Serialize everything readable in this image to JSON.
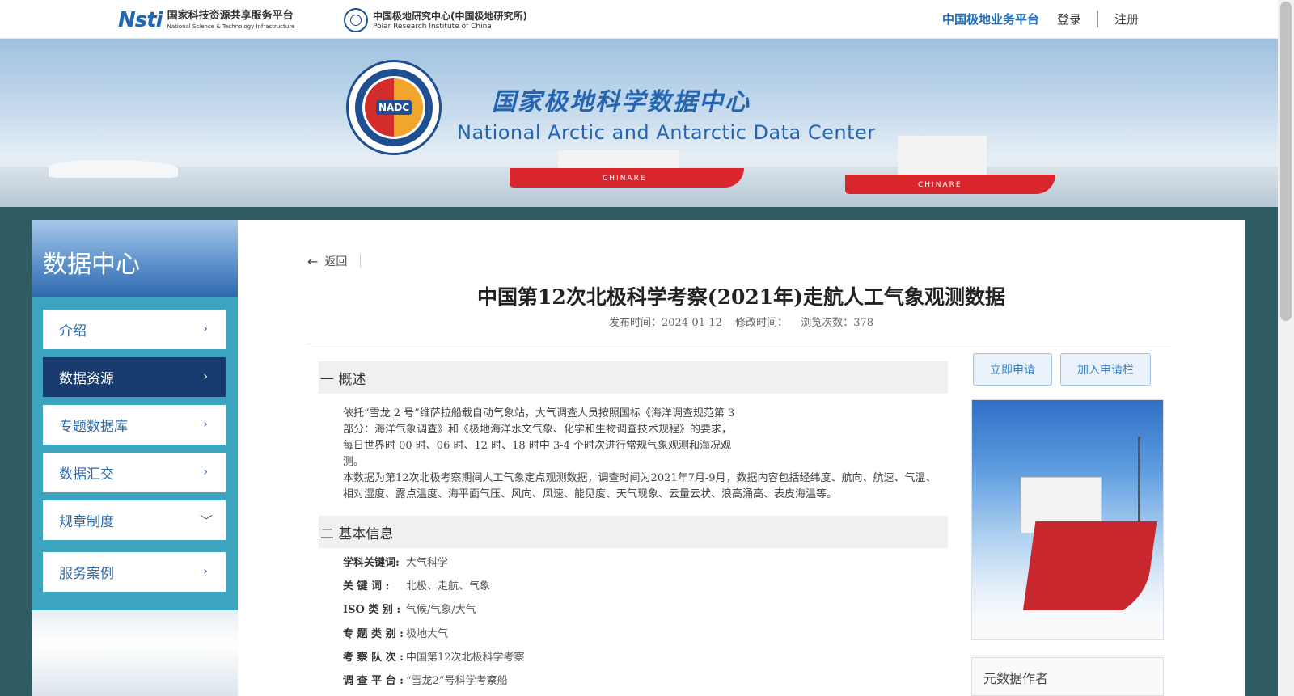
{
  "topbar": {
    "nsti_mark": "Nsti",
    "nsti_cn": "国家科技资源共享服务平台",
    "nsti_en": "National Science & Technology Infrastructure",
    "pric_cn": "中国极地研究中心(中国极地研究所)",
    "pric_en": "Polar Research Institute of China",
    "platform": "中国极地业务平台",
    "login": "登录",
    "register": "注册"
  },
  "banner": {
    "seal_text": "NADC",
    "title_cn": "国家极地科学数据中心",
    "title_en": "National Arctic and Antarctic Data Center",
    "ship_label": "CHINARE"
  },
  "sidebar": {
    "title": "数据中心",
    "items": [
      {
        "label": "介绍",
        "icon": "chevron-right-icon",
        "glyph": "›"
      },
      {
        "label": "数据资源",
        "icon": "chevron-right-icon",
        "glyph": "›",
        "active": true
      },
      {
        "label": "专题数据库",
        "icon": "chevron-right-icon",
        "glyph": "›"
      },
      {
        "label": "数据汇交",
        "icon": "chevron-right-icon",
        "glyph": "›"
      },
      {
        "label": "规章制度",
        "icon": "chevron-down-icon",
        "glyph": "﹀"
      },
      {
        "label": "服务案例",
        "icon": "chevron-right-icon",
        "glyph": "›"
      }
    ]
  },
  "content": {
    "back_label": "返回",
    "title": "中国第12次北极科学考察(2021年)走航人工气象观测数据",
    "meta": {
      "publish": "发布时间：2024-01-12",
      "modify": "修改时间：",
      "views": "浏览次数：378"
    },
    "section1": "一 概述",
    "overview_p1": "依托“雪龙 2 号”维萨拉船载自动气象站，大气调查人员按照国标《海洋调查规范第 3 部分：海洋气象调查》和《极地海洋水文气象、化学和生物调查技术规程》的要求，每日世界时 00 时、06 时、12 时、18 时中 3-4 个时次进行常规气象观测和海况观测。",
    "overview_p2": "本数据为第12次北极考察期间人工气象定点观测数据，调查时间为2021年7月-9月，数据内容包括经纬度、航向、航速、气温、相对湿度、露点温度、海平面气压、风向、风速、能见度、天气现象、云量云状、浪高涌高、表皮海温等。",
    "section2": "二 基本信息",
    "info": [
      {
        "key": "学科关键词:",
        "value": "大气科学"
      },
      {
        "key": "关 键 词 :",
        "value": "北极、走航、气象"
      },
      {
        "key": "ISO 类 别 :",
        "value": "气候/气象/大气"
      },
      {
        "key": "专 题 类 别 :",
        "value": "极地大气"
      },
      {
        "key": "考 察 队 次 :",
        "value": "中国第12次北极科学考察"
      },
      {
        "key": "调 查 平 台 :",
        "value": "“雪龙2”号科学考察船"
      }
    ],
    "apply_button": "立即申请",
    "add_button": "加入申请栏",
    "author_box": "元数据作者"
  }
}
